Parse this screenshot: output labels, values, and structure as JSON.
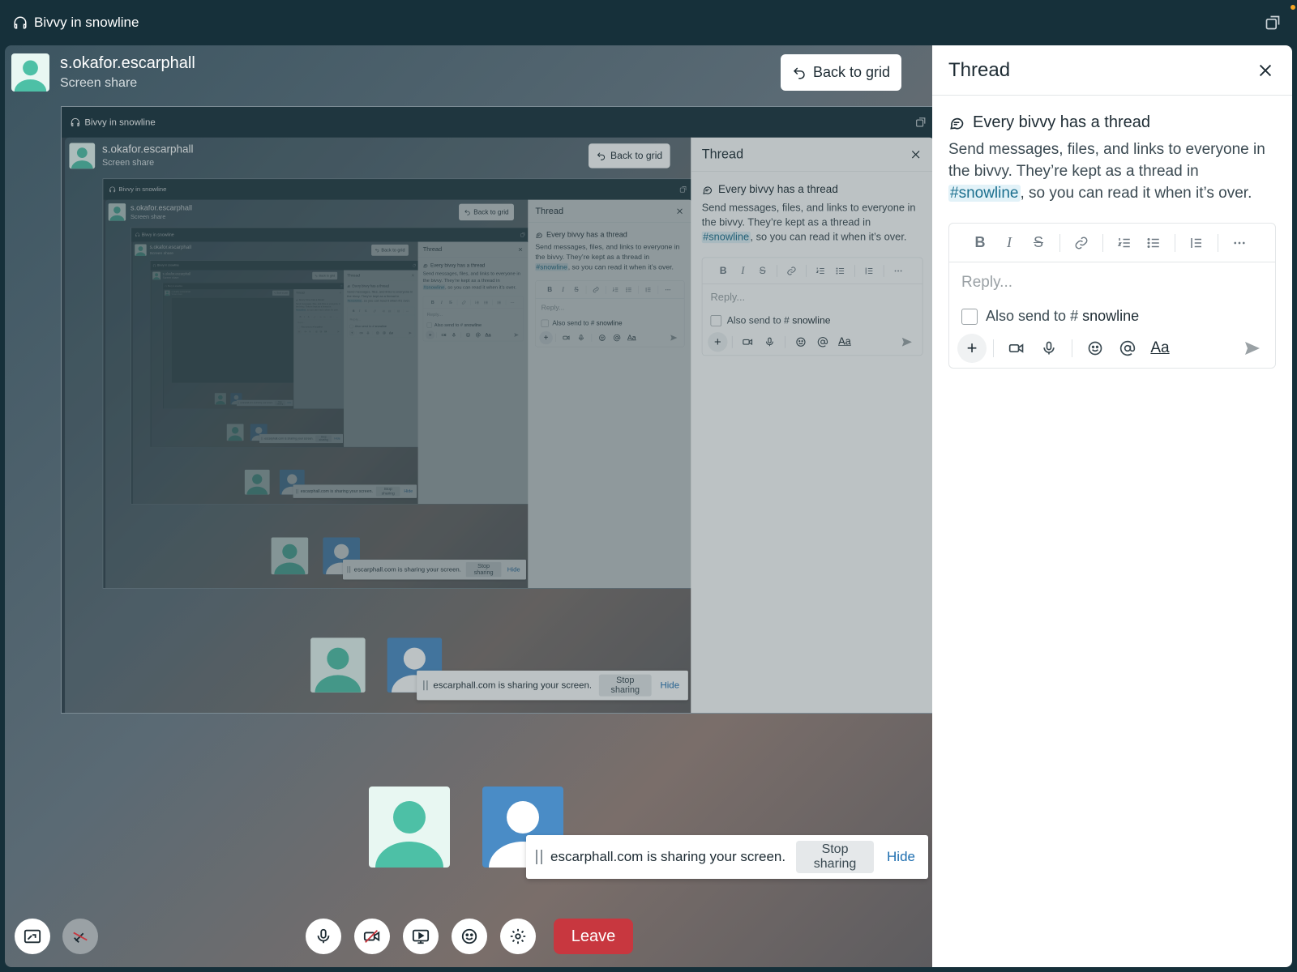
{
  "window": {
    "title": "Bivvy in snowline"
  },
  "presenter": {
    "name": "s.okafor.escarphall",
    "subtitle": "Screen share"
  },
  "stage": {
    "back_label": "Back to grid"
  },
  "share_banner": {
    "text": "escarphall.com is sharing your screen.",
    "stop_label": "Stop sharing",
    "hide_label": "Hide"
  },
  "controls": {
    "leave_label": "Leave",
    "icons": [
      "layout-icon",
      "pen-off-icon",
      "mic-icon",
      "camera-off-icon",
      "share-screen-icon",
      "emoji-icon",
      "settings-icon"
    ]
  },
  "thread": {
    "title": "Thread",
    "intro_heading": "Every bivvy has a thread",
    "intro_text_before": "Send messages, files, and links to everyone in the bivvy. They’re kept as a thread in ",
    "intro_channel": "#snowline",
    "intro_text_after": ", so you can read it when it’s over.",
    "reply_placeholder": "Reply...",
    "also_send_prefix": "Also send to #",
    "also_send_channel": "snowline",
    "format_buttons": [
      "B",
      "I",
      "S"
    ],
    "text_style_label": "Aa"
  },
  "colors": {
    "leave": "#c8373f",
    "accent_link": "#1f6fb0",
    "background": "#16303a",
    "avatar_teal": "#4dc0a6",
    "avatar_blue": "#4a8cc6"
  }
}
